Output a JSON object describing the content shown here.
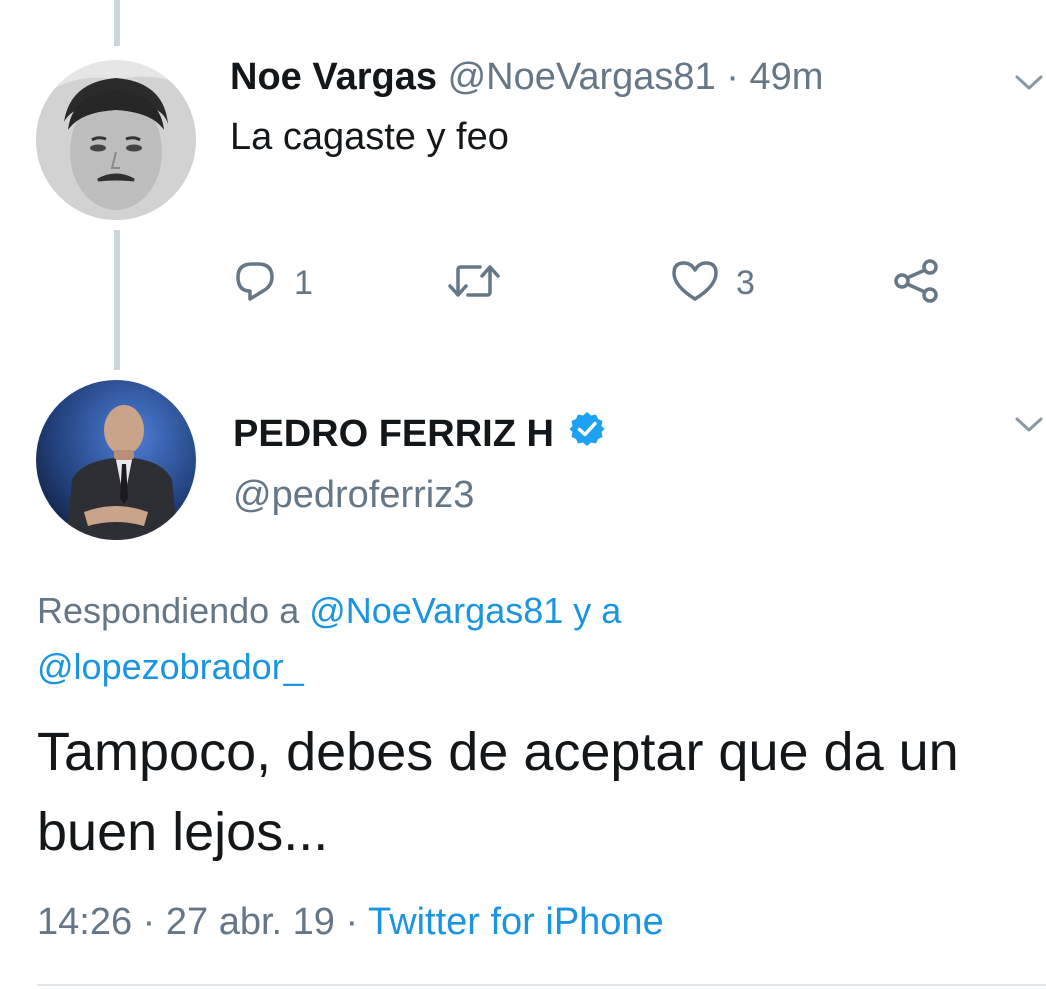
{
  "colors": {
    "text_primary": "#14171a",
    "text_secondary": "#657786",
    "link": "#1b95e0",
    "thread_line": "#ccd6dd",
    "verified": "#1da1f2"
  },
  "tweet1": {
    "author_name": "Noe Vargas",
    "author_handle": "@NoeVargas81",
    "separator": "·",
    "time": "49m",
    "text": "La cagaste y feo",
    "actions": {
      "reply_icon": "reply-icon",
      "reply_count": "1",
      "retweet_icon": "retweet-icon",
      "like_icon": "heart-icon",
      "like_count": "3",
      "share_icon": "share-icon"
    }
  },
  "tweet2": {
    "author_name": "PEDRO FERRIZ H",
    "verified_icon": "verified-badge-icon",
    "author_handle": "@pedroferriz3",
    "replying_prefix": "Respondiendo a",
    "replying_mention_1": "@NoeVargas81",
    "replying_joiner": "y a",
    "replying_mention_2": "@lopezobrador_",
    "text": "Tampoco, debes de aceptar que da un buen lejos...",
    "time": "14:26",
    "separator": "·",
    "date": "27 abr. 19",
    "source": "Twitter for iPhone"
  }
}
